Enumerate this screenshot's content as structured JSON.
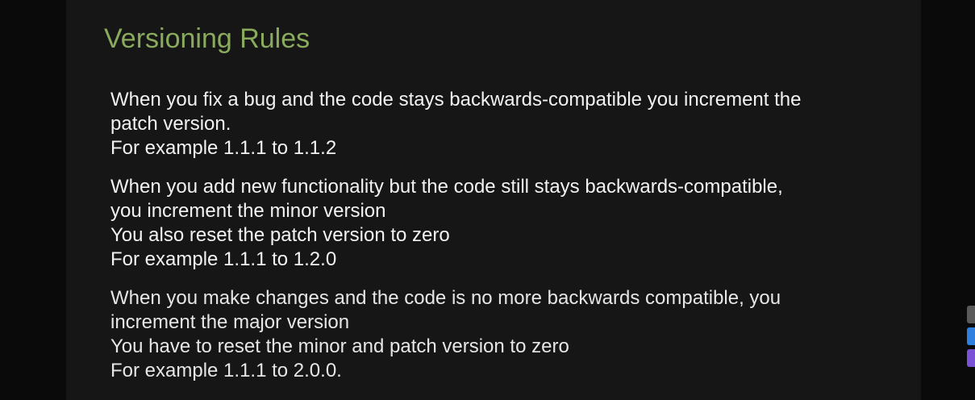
{
  "slide": {
    "title": "Versioning Rules",
    "paragraphs": [
      {
        "lines": [
          "When you fix a bug and the code stays backwards-compatible you increment the",
          "patch version.",
          "For example 1.1.1 to 1.1.2"
        ]
      },
      {
        "lines": [
          "When you add new functionality but the code still stays backwards-compatible,",
          "you increment the minor version",
          "You also reset the patch version to zero",
          "For example 1.1.1 to 1.2.0"
        ]
      },
      {
        "lines": [
          "When you make changes and the code is no more backwards compatible, you",
          "increment the major version",
          "You have to reset the minor and patch version to zero",
          "For example 1.1.1 to 2.0.0."
        ]
      }
    ]
  },
  "colors": {
    "background": "#0a0a0a",
    "slide_background": "#161616",
    "title": "#8aaa5e",
    "text": "#f2f2f2"
  },
  "side_widgets": [
    {
      "icon": "gray-widget-icon"
    },
    {
      "icon": "blue-widget-icon"
    },
    {
      "icon": "purple-widget-icon"
    }
  ]
}
